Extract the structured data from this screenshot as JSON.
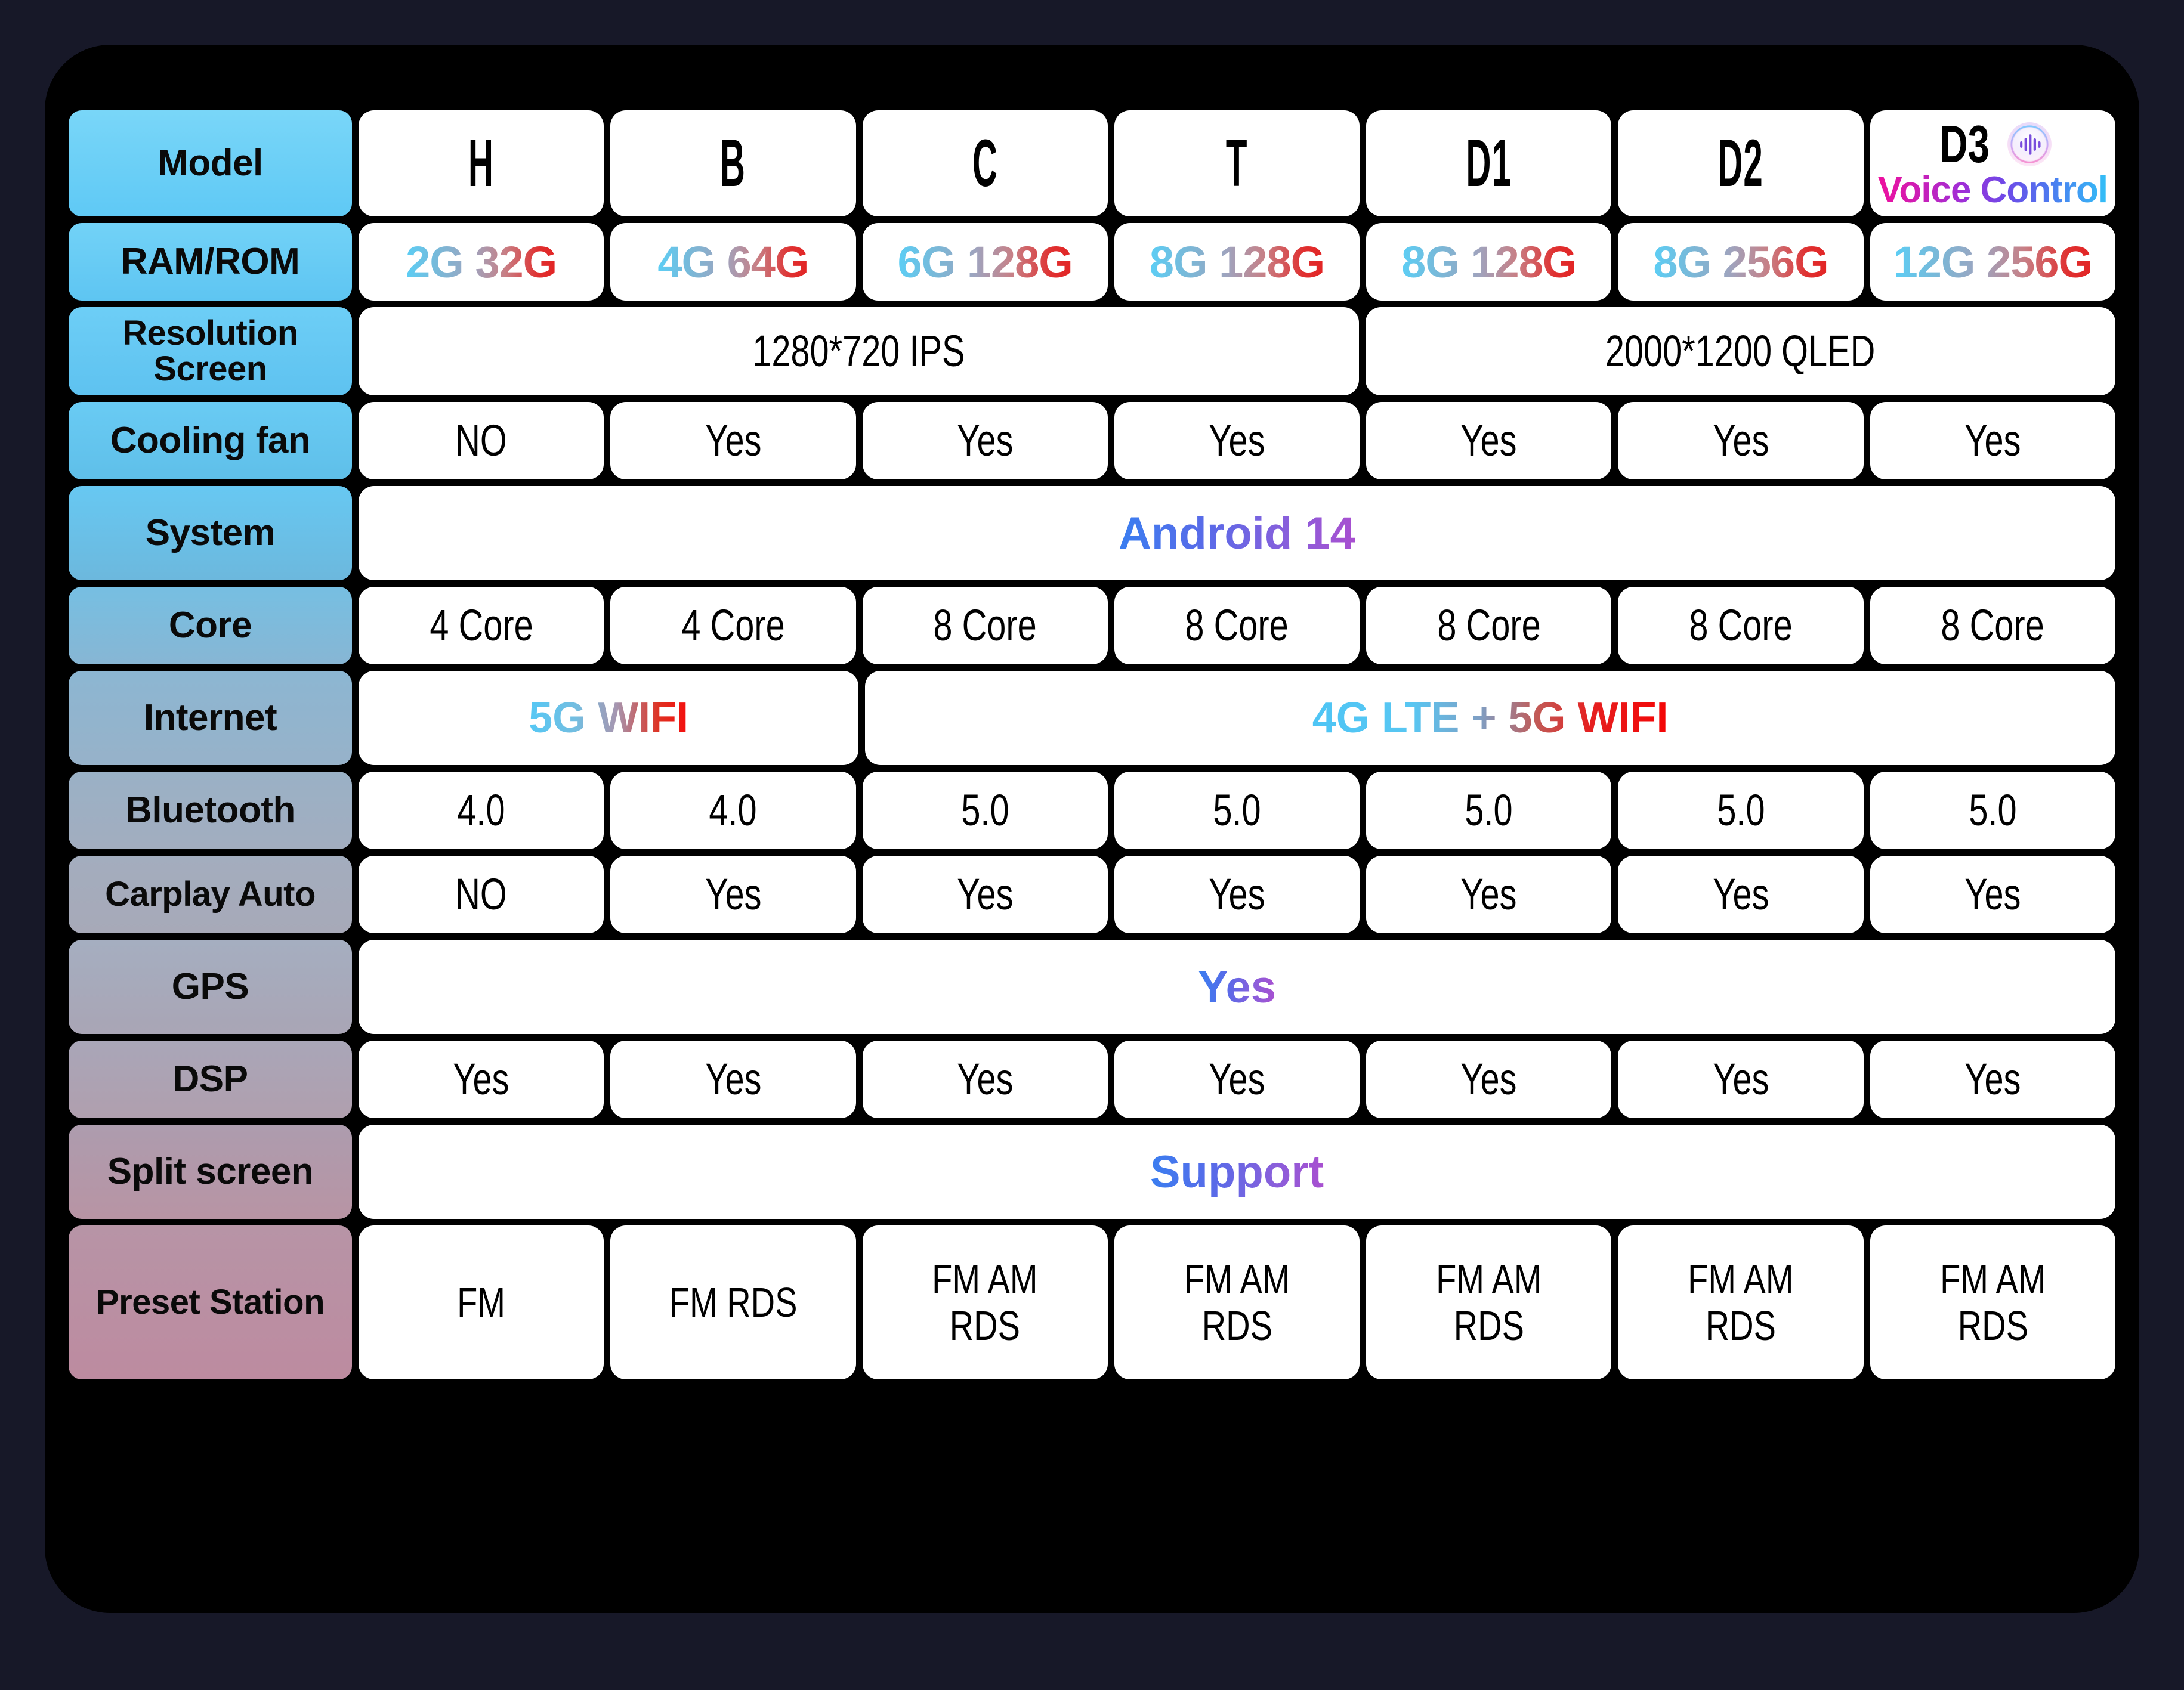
{
  "theme": {
    "page_background": "#171828",
    "frame_background": "#000000",
    "cell_background": "#ffffff",
    "label_top_color": "#66cdf5",
    "label_bottom_color": "#bf8ba0",
    "accent_blue": "#3a7ef0",
    "accent_purple": "#a84fd0",
    "accent_red": "#e22424",
    "accent_cyan": "#5ccef5",
    "accent_magenta": "#ee0f9e"
  },
  "columns": [
    {
      "key": "h",
      "model": "H"
    },
    {
      "key": "b",
      "model": "B"
    },
    {
      "key": "c",
      "model": "C"
    },
    {
      "key": "t",
      "model": "T"
    },
    {
      "key": "d1",
      "model": "D1"
    },
    {
      "key": "d2",
      "model": "D2"
    },
    {
      "key": "d3",
      "model": "D3"
    }
  ],
  "d3": {
    "letters": "D3",
    "subtitle": "Voice Control",
    "icon": "voice-waveform-icon"
  },
  "rows": {
    "model": {
      "label": "Model",
      "values": [
        "H",
        "B",
        "C",
        "T",
        "D1",
        "D2",
        "D3"
      ]
    },
    "ram_rom": {
      "label": "RAM/ROM",
      "values": [
        "2G 32G",
        "4G 64G",
        "6G 128G",
        "8G 128G",
        "8G 128G",
        "8G 256G",
        "12G 256G"
      ]
    },
    "resolution_screen": {
      "label_line1": "Resolution",
      "label_line2": "Screen",
      "values": [
        "1280*720 IPS",
        "2000*1200 QLED"
      ],
      "spans": [
        4,
        3
      ]
    },
    "cooling_fan": {
      "label": "Cooling fan",
      "values": [
        "NO",
        "Yes",
        "Yes",
        "Yes",
        "Yes",
        "Yes",
        "Yes"
      ]
    },
    "system": {
      "label": "System",
      "values": [
        "Android 14"
      ],
      "spans": [
        7
      ]
    },
    "core": {
      "label": "Core",
      "values": [
        "4 Core",
        "4 Core",
        "8 Core",
        "8 Core",
        "8 Core",
        "8 Core",
        "8 Core"
      ]
    },
    "internet": {
      "label": "Internet",
      "values": [
        "5G WIFI",
        "4G LTE + 5G WIFI"
      ],
      "spans": [
        2,
        5
      ]
    },
    "bluetooth": {
      "label": "Bluetooth",
      "values": [
        "4.0",
        "4.0",
        "5.0",
        "5.0",
        "5.0",
        "5.0",
        "5.0"
      ]
    },
    "carplay_auto": {
      "label": "Carplay Auto",
      "values": [
        "NO",
        "Yes",
        "Yes",
        "Yes",
        "Yes",
        "Yes",
        "Yes"
      ]
    },
    "gps": {
      "label": "GPS",
      "values": [
        "Yes"
      ],
      "spans": [
        7
      ]
    },
    "dsp": {
      "label": "DSP",
      "values": [
        "Yes",
        "Yes",
        "Yes",
        "Yes",
        "Yes",
        "Yes",
        "Yes"
      ]
    },
    "split_screen": {
      "label": "Split screen",
      "values": [
        "Support"
      ],
      "spans": [
        7
      ]
    },
    "preset_station": {
      "label": "Preset Station",
      "values": [
        "FM",
        "FM RDS",
        "FM AM\nRDS",
        "FM AM\nRDS",
        "FM AM\nRDS",
        "FM AM\nRDS",
        "FM AM\nRDS"
      ]
    }
  }
}
